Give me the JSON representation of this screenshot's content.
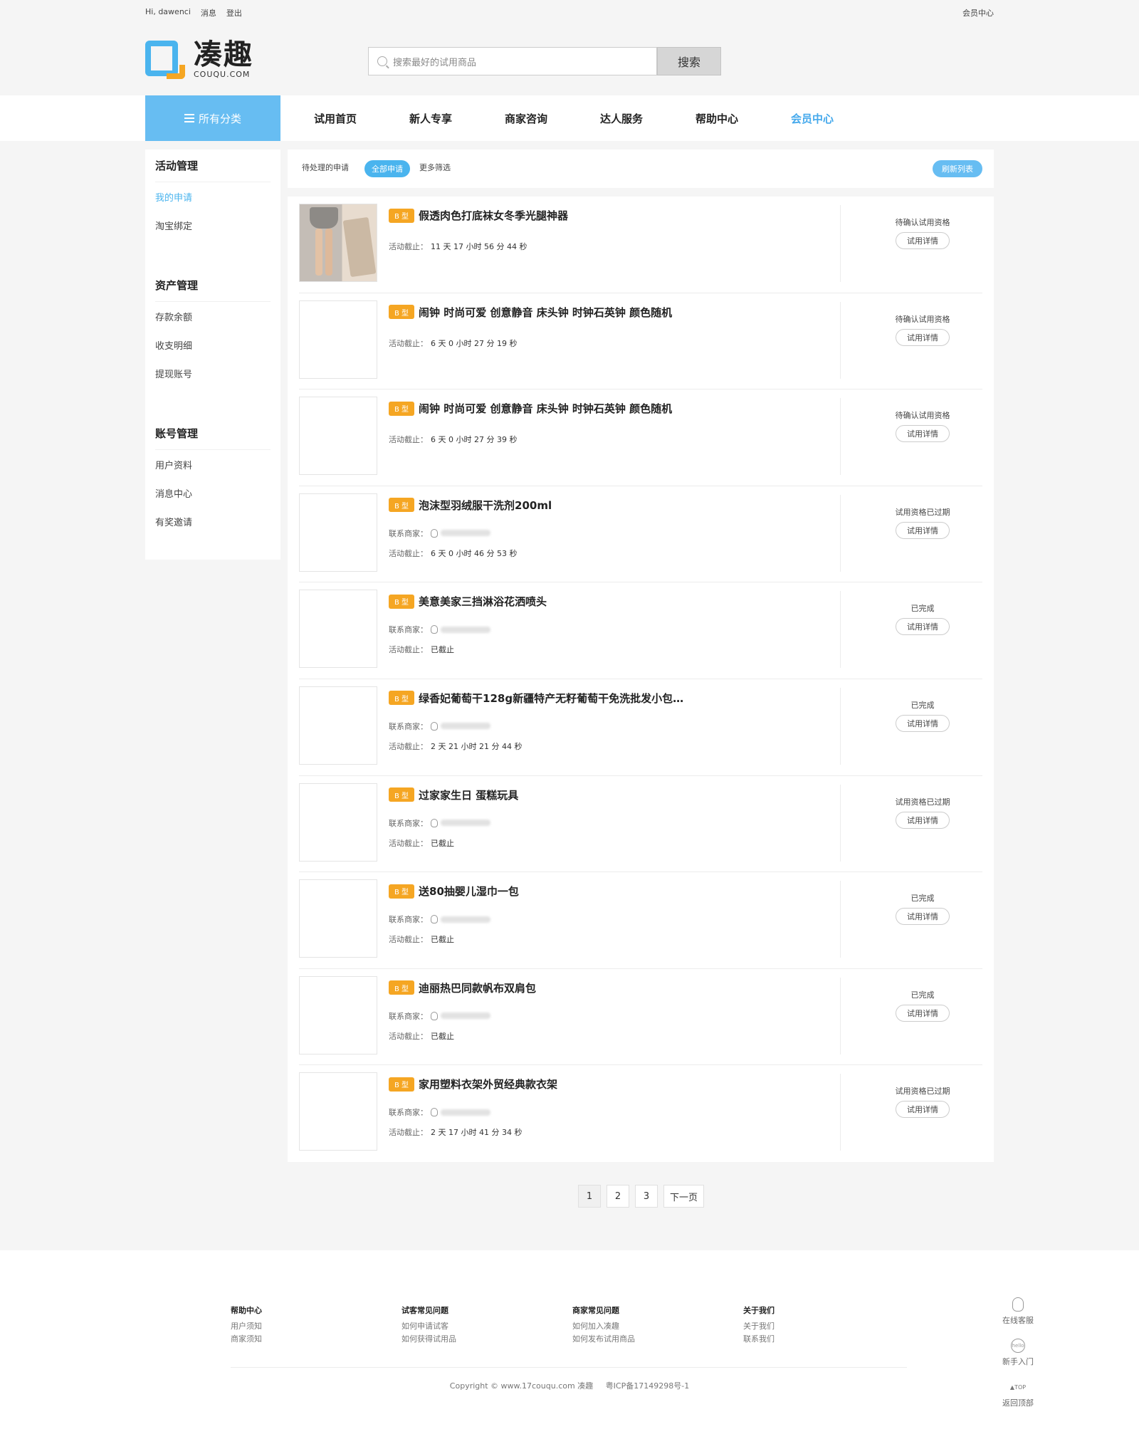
{
  "topbar": {
    "greeting": "Hi,",
    "username": "dawenci",
    "messages": "消息",
    "logout": "登出",
    "member_center": "会员中心"
  },
  "logo": {
    "cn": "凑趣",
    "en": "COUQU.COM"
  },
  "search": {
    "placeholder": "搜索最好的试用商品",
    "button": "搜索"
  },
  "nav": {
    "category": "所有分类",
    "items": [
      "试用首页",
      "新人专享",
      "商家咨询",
      "达人服务",
      "帮助中心",
      "会员中心"
    ],
    "active_index": 5
  },
  "sidebar": {
    "groups": [
      {
        "title": "活动管理",
        "items": [
          "我的申请",
          "淘宝绑定"
        ]
      },
      {
        "title": "资产管理",
        "items": [
          "存款余额",
          "收支明细",
          "提现账号"
        ]
      },
      {
        "title": "账号管理",
        "items": [
          "用户资料",
          "消息中心",
          "有奖邀请"
        ]
      }
    ],
    "active_item": "我的申请"
  },
  "filter": {
    "pending": "待处理的申请",
    "all": "全部申请",
    "more": "更多筛选",
    "refresh": "刷新列表"
  },
  "labels": {
    "badge": "B 型",
    "contact": "联系商家：",
    "deadline": "活动截止：",
    "detail_button": "试用详情"
  },
  "applications": [
    {
      "title": "假透肉色打底袜女冬季光腿神器",
      "has_photo": true,
      "has_contact": false,
      "deadline": "11 天 17 小时 56 分 44 秒",
      "status": "待确认试用资格"
    },
    {
      "title": "闹钟 时尚可爱 创意静音 床头钟 时钟石英钟 颜色随机",
      "has_photo": false,
      "has_contact": false,
      "deadline": "6 天 0 小时 27 分 19 秒",
      "status": "待确认试用资格"
    },
    {
      "title": "闹钟 时尚可爱 创意静音 床头钟 时钟石英钟 颜色随机",
      "has_photo": false,
      "has_contact": false,
      "deadline": "6 天 0 小时 27 分 39 秒",
      "status": "待确认试用资格"
    },
    {
      "title": "泡沫型羽绒服干洗剂200ml",
      "has_photo": false,
      "has_contact": true,
      "deadline": "6 天 0 小时 46 分 53 秒",
      "status": "试用资格已过期"
    },
    {
      "title": "美意美家三挡淋浴花洒喷头",
      "has_photo": false,
      "has_contact": true,
      "deadline": "已截止",
      "status": "已完成"
    },
    {
      "title": "绿香妃葡萄干128g新疆特产无籽葡萄干免洗批发小包…",
      "has_photo": false,
      "has_contact": true,
      "deadline": "2 天 21 小时 21 分 44 秒",
      "status": "已完成"
    },
    {
      "title": "过家家生日 蛋糕玩具",
      "has_photo": false,
      "has_contact": true,
      "deadline": "已截止",
      "status": "试用资格已过期"
    },
    {
      "title": "送80抽婴儿湿巾一包",
      "has_photo": false,
      "has_contact": true,
      "deadline": "已截止",
      "status": "已完成"
    },
    {
      "title": "迪丽热巴同款帆布双肩包",
      "has_photo": false,
      "has_contact": true,
      "deadline": "已截止",
      "status": "已完成"
    },
    {
      "title": "家用塑料衣架外贸经典款衣架",
      "has_photo": false,
      "has_contact": true,
      "deadline": "2 天 17 小时 41 分 34 秒",
      "status": "试用资格已过期"
    }
  ],
  "pagination": {
    "pages": [
      "1",
      "2",
      "3"
    ],
    "current": "1",
    "next": "下一页"
  },
  "footer": {
    "columns": [
      {
        "title": "帮助中心",
        "links": [
          "用户须知",
          "商家须知"
        ]
      },
      {
        "title": "试客常见问题",
        "links": [
          "如何申请试客",
          "如何获得试用品"
        ]
      },
      {
        "title": "商家常见问题",
        "links": [
          "如何加入凑趣",
          "如何发布试用商品"
        ]
      },
      {
        "title": "关于我们",
        "links": [
          "关于我们",
          "联系我们"
        ]
      }
    ],
    "copyright": "Copyright © www.17couqu.com 凑趣",
    "icp": "粤ICP备17149298号-1"
  },
  "side_tools": {
    "service": "在线客服",
    "newbie": "新手入门",
    "newbie_icon_text": "hello",
    "top_icon_text": "TOP",
    "back_top": "返回顶部"
  }
}
